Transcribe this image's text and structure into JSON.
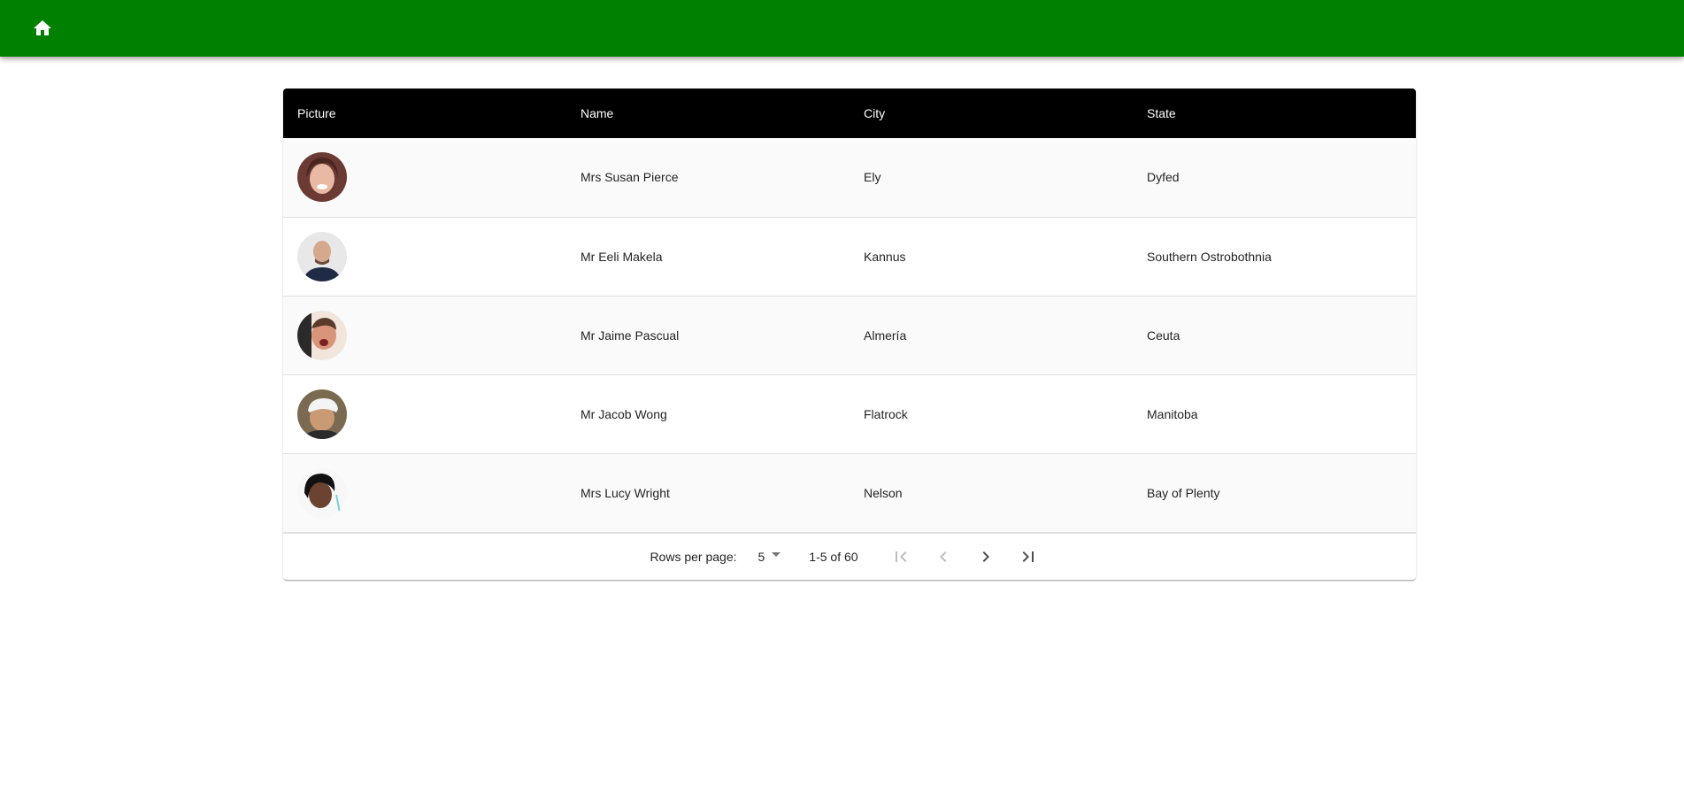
{
  "appbar": {
    "color": "#008000",
    "home_icon": "home-icon"
  },
  "table": {
    "header_bg": "#000000",
    "columns": [
      "Picture",
      "Name",
      "City",
      "State"
    ],
    "rows": [
      {
        "picture_icon": "avatar-photo",
        "name": "Mrs Susan Pierce",
        "city": "Ely",
        "state": "Dyfed"
      },
      {
        "picture_icon": "avatar-photo",
        "name": "Mr Eeli Makela",
        "city": "Kannus",
        "state": "Southern Ostrobothnia"
      },
      {
        "picture_icon": "avatar-photo",
        "name": "Mr Jaime Pascual",
        "city": "Almería",
        "state": "Ceuta"
      },
      {
        "picture_icon": "avatar-photo",
        "name": "Mr Jacob Wong",
        "city": "Flatrock",
        "state": "Manitoba"
      },
      {
        "picture_icon": "avatar-photo",
        "name": "Mrs Lucy Wright",
        "city": "Nelson",
        "state": "Bay of Plenty"
      }
    ]
  },
  "pagination": {
    "rows_per_page_label": "Rows per page:",
    "rows_per_page_value": "5",
    "range_text": "1-5 of 60",
    "first_icon": "first-page-icon",
    "prev_icon": "chevron-left-icon",
    "next_icon": "chevron-right-icon",
    "last_icon": "last-page-icon"
  }
}
